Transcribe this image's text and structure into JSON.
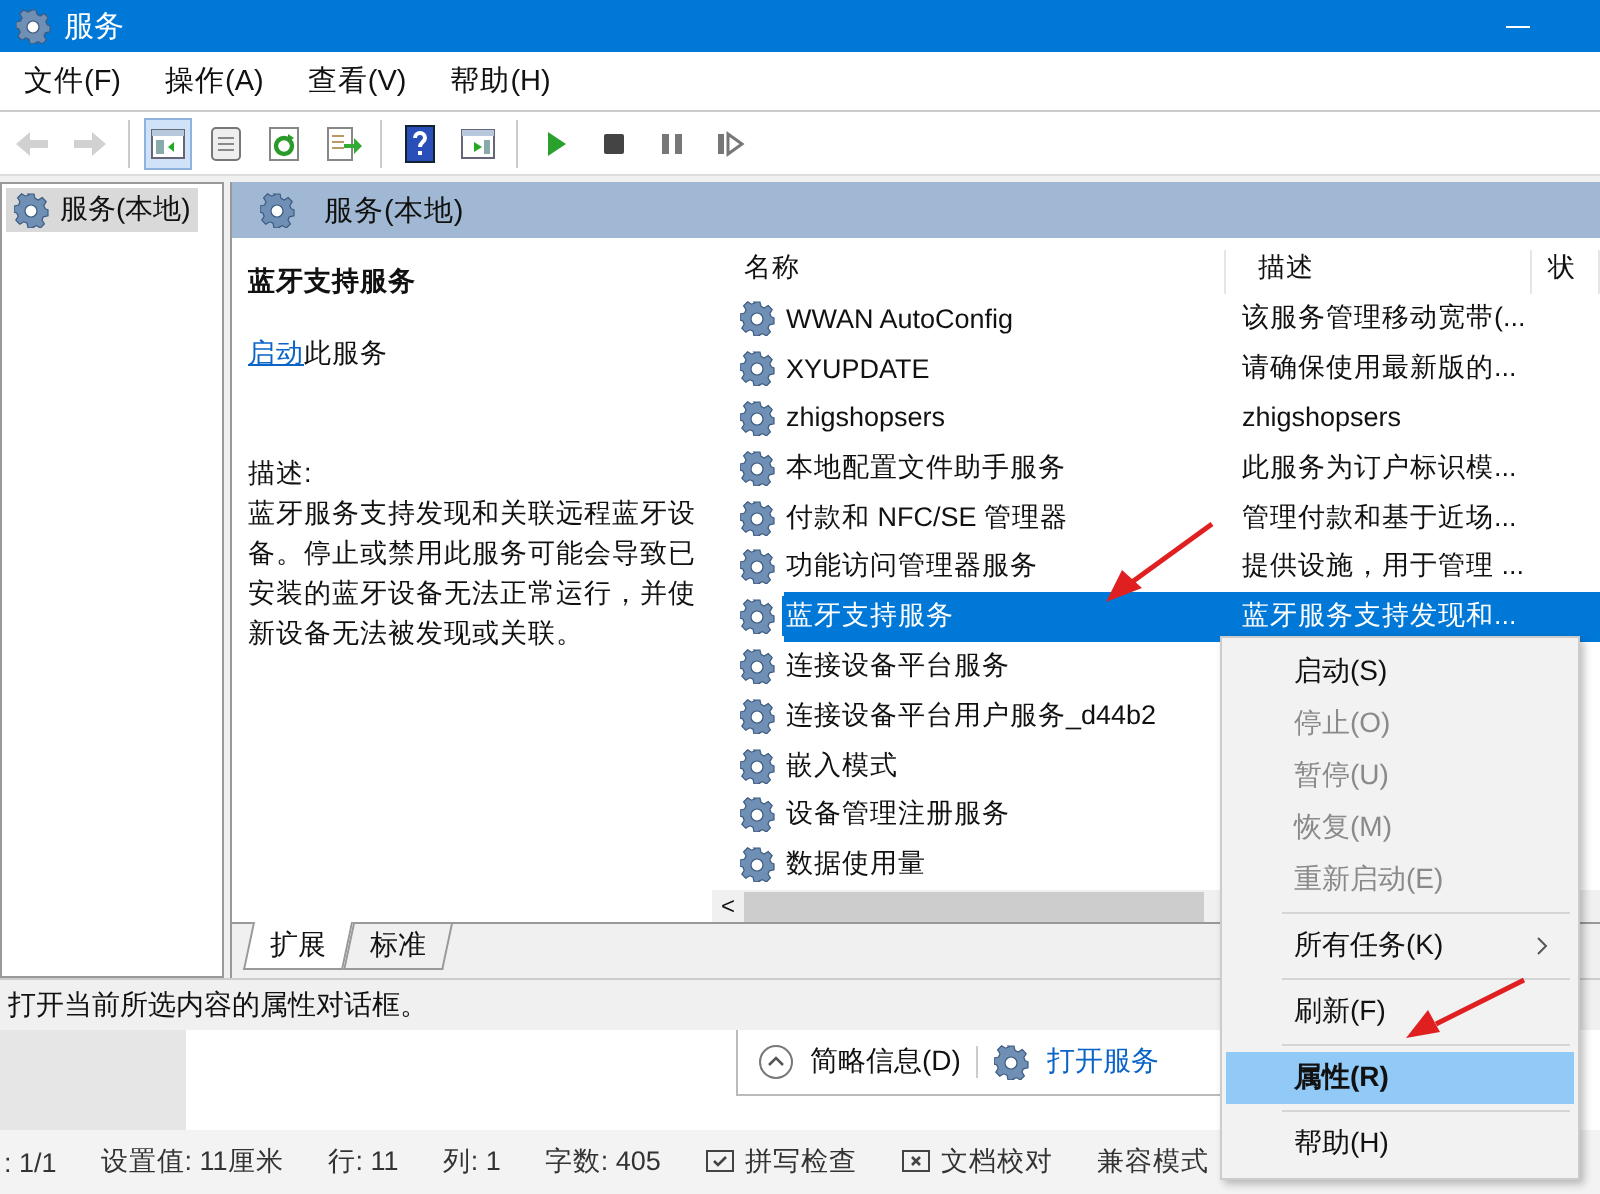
{
  "window": {
    "title": "服务"
  },
  "menu_bar": [
    {
      "label": "文件(F)"
    },
    {
      "label": "操作(A)"
    },
    {
      "label": "查看(V)"
    },
    {
      "label": "帮助(H)"
    }
  ],
  "toolbar": [
    [
      {
        "kind": "back",
        "disabled": true,
        "pressed": false
      },
      {
        "kind": "forward",
        "disabled": true,
        "pressed": false
      }
    ],
    [
      {
        "kind": "tree",
        "disabled": false,
        "pressed": true
      },
      {
        "kind": "properties",
        "disabled": false,
        "pressed": false
      },
      {
        "kind": "refresh",
        "disabled": false,
        "pressed": false
      },
      {
        "kind": "export",
        "disabled": false,
        "pressed": false
      }
    ],
    [
      {
        "kind": "help",
        "disabled": false,
        "pressed": false
      },
      {
        "kind": "console",
        "disabled": false,
        "pressed": false
      }
    ],
    [
      {
        "kind": "start",
        "disabled": false,
        "pressed": false
      },
      {
        "kind": "stop",
        "disabled": false,
        "pressed": false
      },
      {
        "kind": "pause",
        "disabled": false,
        "pressed": false
      },
      {
        "kind": "restart",
        "disabled": false,
        "pressed": false
      }
    ]
  ],
  "scrollbar": {
    "left_arrow": "<"
  },
  "tree": [
    {
      "label": "服务(本地)",
      "selected": true
    }
  ],
  "panel": {
    "title": "服务(本地)"
  },
  "detail": {
    "title": "蓝牙支持服务",
    "link": "启动",
    "action_text": "此服务",
    "desc_label": "描述:",
    "description": "蓝牙服务支持发现和关联远程蓝牙设备。停止或禁用此服务可能会导致已安装的蓝牙设备无法正常运行，并使新设备无法被发现或关联。"
  },
  "table": {
    "columns": [
      "名称",
      "描述",
      "状"
    ],
    "rows": [
      {
        "name": "WWAN AutoConfig",
        "description": "该服务管理移动宽带(...",
        "selected": false
      },
      {
        "name": "XYUPDATE",
        "description": "请确保使用最新版的...",
        "selected": false
      },
      {
        "name": "zhigshopsers",
        "description": "zhigshopsers",
        "selected": false
      },
      {
        "name": "本地配置文件助手服务",
        "description": "此服务为订户标识模...",
        "selected": false
      },
      {
        "name": "付款和 NFC/SE 管理器",
        "description": "管理付款和基于近场...",
        "selected": false
      },
      {
        "name": "功能访问管理器服务",
        "description": "提供设施，用于管理 ...",
        "selected": false
      },
      {
        "name": "蓝牙支持服务",
        "description": "蓝牙服务支持发现和...",
        "selected": true
      },
      {
        "name": "连接设备平台服务",
        "selected": false
      },
      {
        "name": "连接设备平台用户服务_d44b2",
        "selected": false
      },
      {
        "name": "嵌入模式",
        "selected": false
      },
      {
        "name": "设备管理注册服务",
        "selected": false
      },
      {
        "name": "数据使用量",
        "selected": false
      }
    ]
  },
  "tabs": [
    {
      "label": "扩展",
      "selected": true
    },
    {
      "label": "标准",
      "selected": false
    }
  ],
  "status_bar": "打开当前所选内容的属性对话框。",
  "background_dialog": {
    "toggle": "简略信息(D)",
    "link": "打开服务"
  },
  "editor_status": [
    {
      "text": ": 1/1",
      "kind": "text"
    },
    {
      "text": "设置值: 11厘米",
      "kind": "text"
    },
    {
      "text": "行: 11",
      "kind": "text"
    },
    {
      "text": "列: 1",
      "kind": "text"
    },
    {
      "text": "字数: 405",
      "kind": "text"
    },
    {
      "text": "拼写检查",
      "kind": "spell"
    },
    {
      "text": "文档校对",
      "kind": "proof"
    },
    {
      "text": "兼容模式",
      "kind": "text"
    }
  ],
  "context_menu": [
    {
      "kind": "item",
      "label": "启动(S)",
      "disabled": false,
      "selected": false,
      "bold": false,
      "submenu": false
    },
    {
      "kind": "item",
      "label": "停止(O)",
      "disabled": true,
      "selected": false,
      "bold": false,
      "submenu": false
    },
    {
      "kind": "item",
      "label": "暂停(U)",
      "disabled": true,
      "selected": false,
      "bold": false,
      "submenu": false
    },
    {
      "kind": "item",
      "label": "恢复(M)",
      "disabled": true,
      "selected": false,
      "bold": false,
      "submenu": false
    },
    {
      "kind": "item",
      "label": "重新启动(E)",
      "disabled": true,
      "selected": false,
      "bold": false,
      "submenu": false
    },
    {
      "kind": "separator"
    },
    {
      "kind": "item",
      "label": "所有任务(K)",
      "disabled": false,
      "selected": false,
      "bold": false,
      "submenu": true
    },
    {
      "kind": "separator"
    },
    {
      "kind": "item",
      "label": "刷新(F)",
      "disabled": false,
      "selected": false,
      "bold": false,
      "submenu": false
    },
    {
      "kind": "separator"
    },
    {
      "kind": "item",
      "label": "属性(R)",
      "disabled": false,
      "selected": true,
      "bold": true,
      "submenu": false
    },
    {
      "kind": "separator"
    },
    {
      "kind": "item",
      "label": "帮助(H)",
      "disabled": false,
      "selected": false,
      "bold": false,
      "submenu": false
    }
  ]
}
